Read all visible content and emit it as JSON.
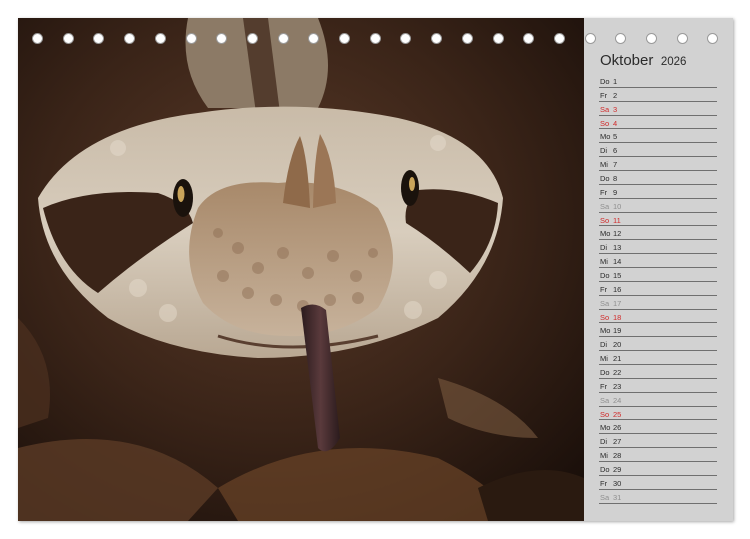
{
  "calendar": {
    "month": "Oktober",
    "year": "2026",
    "days": [
      {
        "wd": "Do",
        "d": "1",
        "type": "weekday"
      },
      {
        "wd": "Fr",
        "d": "2",
        "type": "weekday"
      },
      {
        "wd": "Sa",
        "d": "3",
        "type": "sunday"
      },
      {
        "wd": "So",
        "d": "4",
        "type": "sunday"
      },
      {
        "wd": "Mo",
        "d": "5",
        "type": "weekday"
      },
      {
        "wd": "Di",
        "d": "6",
        "type": "weekday"
      },
      {
        "wd": "Mi",
        "d": "7",
        "type": "weekday"
      },
      {
        "wd": "Do",
        "d": "8",
        "type": "weekday"
      },
      {
        "wd": "Fr",
        "d": "9",
        "type": "weekday"
      },
      {
        "wd": "Sa",
        "d": "10",
        "type": "saturday"
      },
      {
        "wd": "So",
        "d": "11",
        "type": "sunday"
      },
      {
        "wd": "Mo",
        "d": "12",
        "type": "weekday"
      },
      {
        "wd": "Di",
        "d": "13",
        "type": "weekday"
      },
      {
        "wd": "Mi",
        "d": "14",
        "type": "weekday"
      },
      {
        "wd": "Do",
        "d": "15",
        "type": "weekday"
      },
      {
        "wd": "Fr",
        "d": "16",
        "type": "weekday"
      },
      {
        "wd": "Sa",
        "d": "17",
        "type": "saturday"
      },
      {
        "wd": "So",
        "d": "18",
        "type": "sunday"
      },
      {
        "wd": "Mo",
        "d": "19",
        "type": "weekday"
      },
      {
        "wd": "Di",
        "d": "20",
        "type": "weekday"
      },
      {
        "wd": "Mi",
        "d": "21",
        "type": "weekday"
      },
      {
        "wd": "Do",
        "d": "22",
        "type": "weekday"
      },
      {
        "wd": "Fr",
        "d": "23",
        "type": "weekday"
      },
      {
        "wd": "Sa",
        "d": "24",
        "type": "saturday"
      },
      {
        "wd": "So",
        "d": "25",
        "type": "sunday"
      },
      {
        "wd": "Mo",
        "d": "26",
        "type": "weekday"
      },
      {
        "wd": "Di",
        "d": "27",
        "type": "weekday"
      },
      {
        "wd": "Mi",
        "d": "28",
        "type": "weekday"
      },
      {
        "wd": "Do",
        "d": "29",
        "type": "weekday"
      },
      {
        "wd": "Fr",
        "d": "30",
        "type": "weekday"
      },
      {
        "wd": "Sa",
        "d": "31",
        "type": "saturday"
      }
    ]
  },
  "colors": {
    "sidebar": "#d2d2d2",
    "sunday": "#d12a2a",
    "saturday": "#8f8f8f",
    "text": "#2b2b2b"
  },
  "photo": {
    "subject": "snake-head"
  }
}
